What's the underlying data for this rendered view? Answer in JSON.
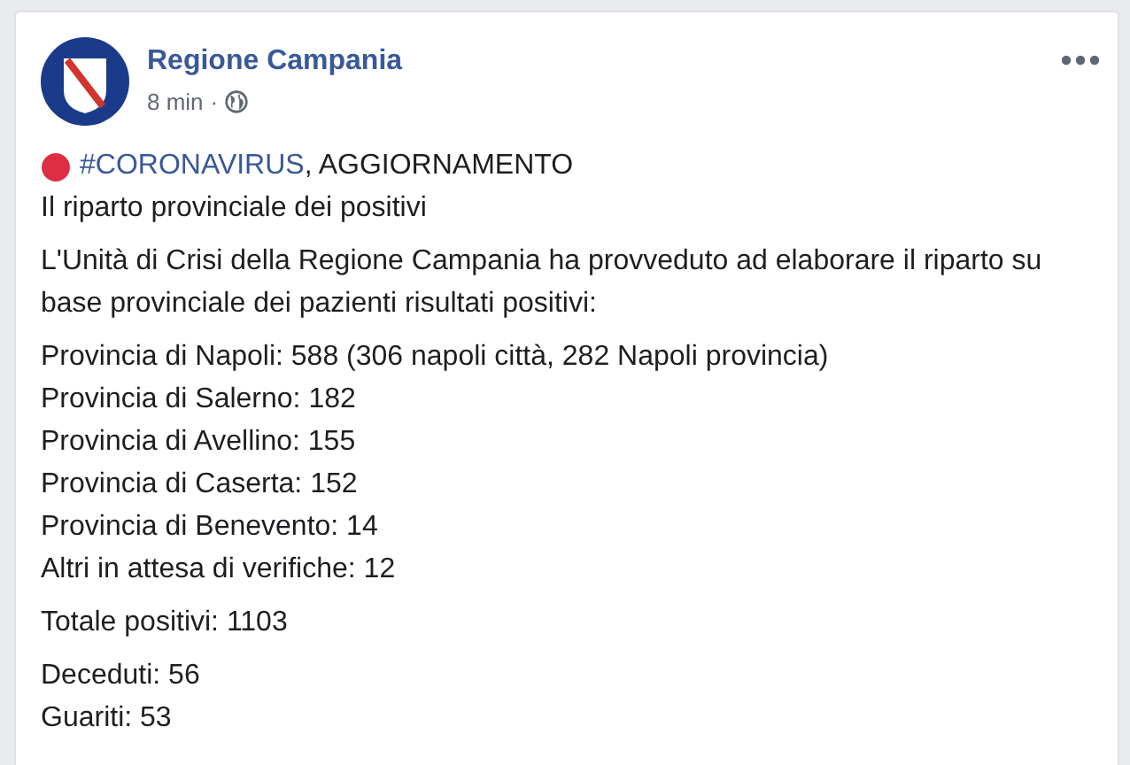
{
  "post": {
    "author": "Regione Campania",
    "time": "8 min",
    "separator": "·",
    "headline": {
      "hashtag": "#CORONAVIRUS",
      "text": ", AGGIORNAMENTO"
    },
    "paragraphs": [
      [
        "Il riparto provinciale dei positivi"
      ],
      [
        "L'Unità di Crisi della Regione Campania ha provveduto ad elaborare il riparto su base provinciale dei pazienti risultati positivi:"
      ],
      [
        "Provincia di Napoli: 588 (306 napoli città, 282 Napoli provincia)",
        "Provincia di Salerno: 182",
        "Provincia di Avellino: 155",
        "Provincia di Caserta: 152",
        "Provincia di Benevento: 14",
        "Altri in attesa di verifiche: 12"
      ],
      [
        "Totale positivi: 1103"
      ],
      [
        "Deceduti: 56",
        "Guariti: 53"
      ]
    ]
  }
}
